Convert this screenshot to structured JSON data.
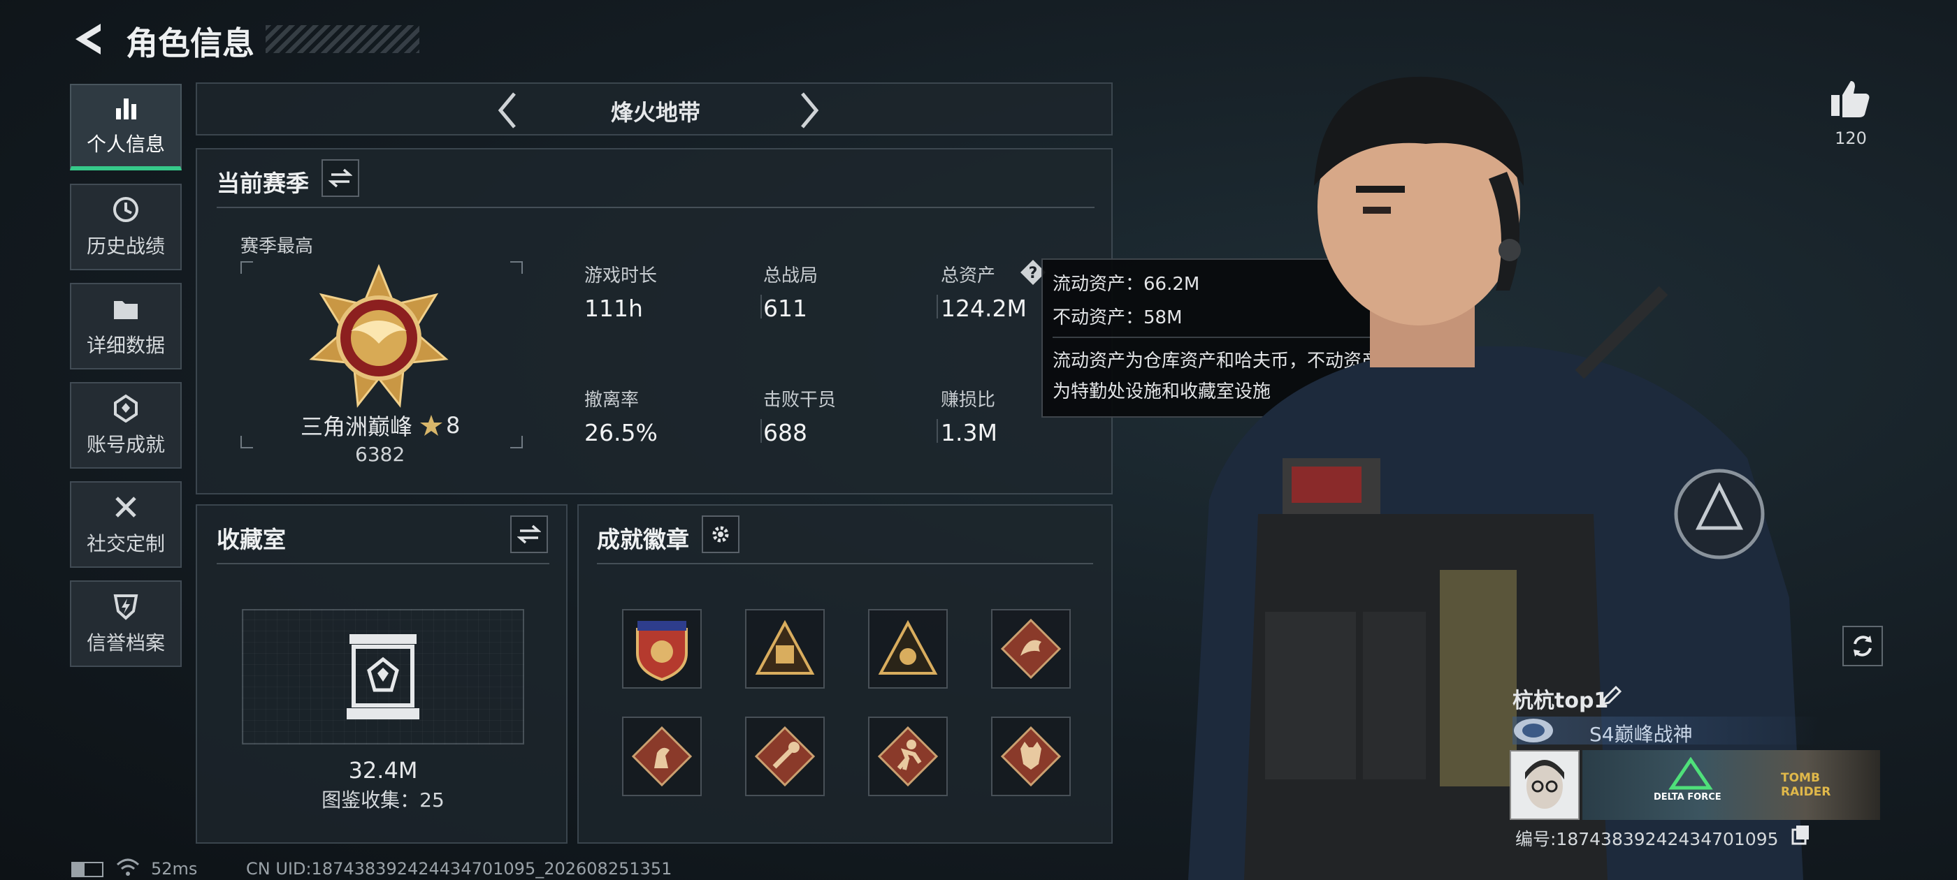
{
  "header": {
    "title": "角色信息",
    "back_icon": "back-arrow-icon"
  },
  "sidebar": {
    "items": [
      {
        "label": "个人信息",
        "icon": "bar-chart-icon",
        "active": true
      },
      {
        "label": "历史战绩",
        "icon": "history-clock-icon",
        "active": false
      },
      {
        "label": "详细数据",
        "icon": "folder-icon",
        "active": false
      },
      {
        "label": "账号成就",
        "icon": "achievement-icon",
        "active": false
      },
      {
        "label": "社交定制",
        "icon": "tools-icon",
        "active": false
      },
      {
        "label": "信誉档案",
        "icon": "shield-bolt-icon",
        "active": false
      }
    ]
  },
  "mode_selector": {
    "label": "烽火地带"
  },
  "season": {
    "title": "当前赛季",
    "highest_label": "赛季最高",
    "rank_name": "三角洲巅峰",
    "rank_stars": "8",
    "rank_score": "6382",
    "stats": [
      {
        "label": "游戏时长",
        "value": "111h"
      },
      {
        "label": "总战局",
        "value": "611"
      },
      {
        "label": "总资产",
        "value": "124.2M"
      },
      {
        "label": "撤离率",
        "value": "26.5%"
      },
      {
        "label": "击败干员",
        "value": "688"
      },
      {
        "label": "赚损比",
        "value": "1.3M"
      }
    ]
  },
  "tooltip": {
    "line1": "流动资产：66.2M",
    "line2": "不动资产：58M",
    "desc1": "流动资产为仓库资产和哈夫币，不动资产",
    "desc2": "为特勤处设施和收藏室设施"
  },
  "collection": {
    "title": "收藏室",
    "value": "32.4M",
    "count_text": "图鉴收集：25"
  },
  "achievements": {
    "title": "成就徽章",
    "badges": [
      "eagle-shield-badge",
      "pyramid-badge",
      "triangle-emblem-badge",
      "dragon-badge",
      "horse-badge",
      "wrench-badge",
      "runner-badge",
      "wolf-badge"
    ]
  },
  "likes": {
    "count": "120"
  },
  "player": {
    "name": "杭杭top1",
    "title": "S4巅峰战神",
    "id_text": "编号:1874383924243470109​5",
    "banner_text1": "DELTA FORCE",
    "banner_text2": "TOMB RAIDER"
  },
  "status_bar": {
    "ping": "52ms",
    "uid": "CN UID:187438392424434701095_202608251351"
  },
  "colors": {
    "accent_green": "#36c98a",
    "rank_gold": "#d8aa55",
    "rank_red": "#8c1f1f"
  }
}
